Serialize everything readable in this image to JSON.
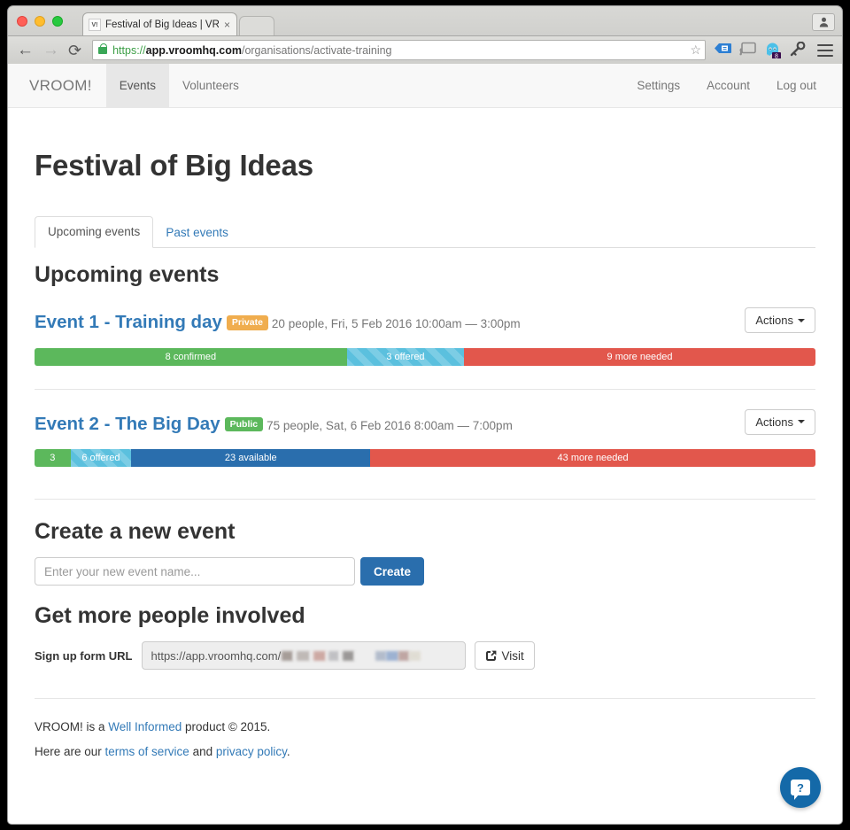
{
  "browser": {
    "tab_title": "Festival of Big Ideas | VROO",
    "tab_favicon_text": "V!",
    "tab_close": "×",
    "back_icon": "←",
    "forward_icon": "→",
    "reload_icon": "⟳",
    "url_scheme": "https://",
    "url_host": "app.vroomhq.com",
    "url_path": "/organisations/activate-training",
    "star_icon": "☆",
    "ghost_badge": "8"
  },
  "appnav": {
    "brand": "VROOM!",
    "left_links": [
      {
        "label": "Events",
        "active": true
      },
      {
        "label": "Volunteers",
        "active": false
      }
    ],
    "right_links": [
      {
        "label": "Settings"
      },
      {
        "label": "Account"
      },
      {
        "label": "Log out"
      }
    ]
  },
  "page": {
    "title": "Festival of Big Ideas",
    "tabs": [
      {
        "label": "Upcoming events",
        "active": true
      },
      {
        "label": "Past events",
        "active": false
      }
    ],
    "section_heading": "Upcoming events"
  },
  "events": [
    {
      "name": "Event 1 - Training day",
      "visibility": "Private",
      "visibility_kind": "private",
      "meta": "20 people, Fri, 5 Feb 2016 10:00am — 3:00pm",
      "actions_label": "Actions",
      "segments": [
        {
          "label": "8 confirmed",
          "kind": "confirmed",
          "value": 8,
          "percent": 40
        },
        {
          "label": "3 offered",
          "kind": "offered",
          "value": 3,
          "percent": 15
        },
        {
          "label": "9 more needed",
          "kind": "needed",
          "value": 9,
          "percent": 45
        }
      ]
    },
    {
      "name": "Event 2 - The Big Day",
      "visibility": "Public",
      "visibility_kind": "public",
      "meta": "75 people, Sat, 6 Feb 2016 8:00am — 7:00pm",
      "actions_label": "Actions",
      "segments": [
        {
          "label": "3",
          "kind": "confirmed",
          "value": 3,
          "percent": 4.6
        },
        {
          "label": "6 offered",
          "kind": "offered",
          "value": 6,
          "percent": 7.8
        },
        {
          "label": "23 available",
          "kind": "available",
          "value": 23,
          "percent": 30.6
        },
        {
          "label": "43 more needed",
          "kind": "needed",
          "value": 43,
          "percent": 57
        }
      ]
    }
  ],
  "create": {
    "heading": "Create a new event",
    "input_value": "",
    "input_placeholder": "Enter your new event name...",
    "button_label": "Create"
  },
  "signup": {
    "heading": "Get more people involved",
    "label": "Sign up form URL",
    "url_visible": "https://app.vroomhq.com/",
    "url_redacted": true,
    "visit_label": "Visit",
    "visit_icon": "↗"
  },
  "footer": {
    "line1_prefix": "VROOM! is a ",
    "line1_link": "Well Informed",
    "line1_suffix": " product © 2015.",
    "line2_prefix": "Here are our ",
    "line2_link1": "terms of service",
    "line2_mid": " and ",
    "line2_link2": "privacy policy",
    "line2_suffix": "."
  },
  "help": {
    "glyph": "?",
    "name": "help-button"
  },
  "colors": {
    "confirmed": "#5cb85c",
    "offered": "#5bc0de",
    "available": "#2a6ead",
    "needed": "#e2574c",
    "link": "#337ab7",
    "private_badge": "#f0ad4e",
    "public_badge": "#5cb85c",
    "primary_button": "#2a6ead"
  }
}
